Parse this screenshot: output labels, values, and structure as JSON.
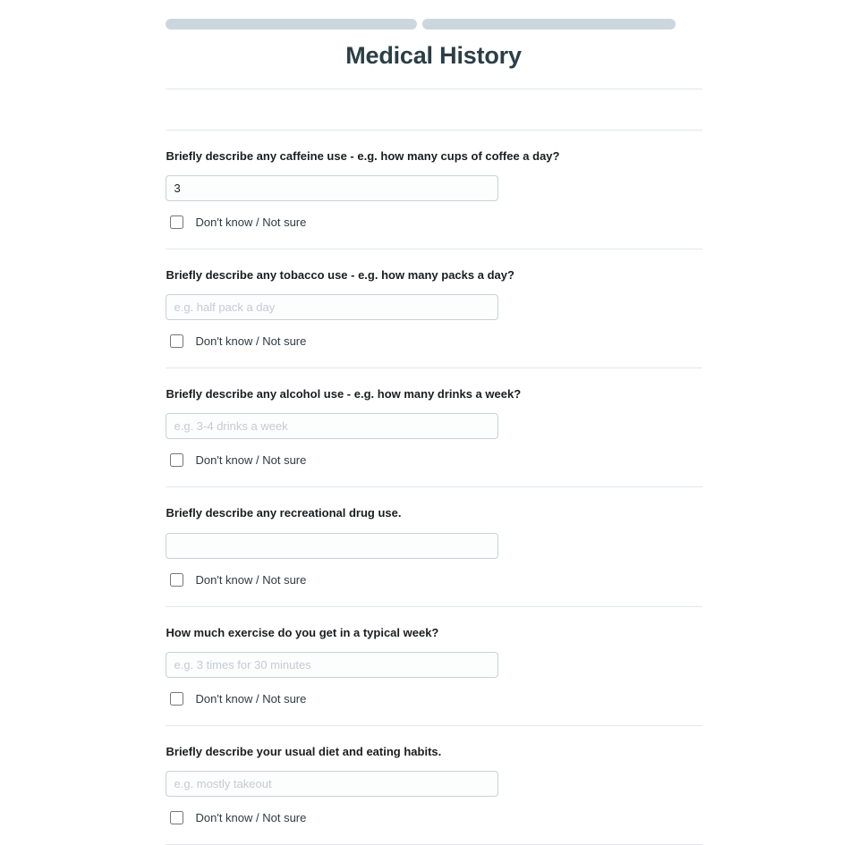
{
  "header": {
    "title": "Medical History",
    "progress": {
      "segments": [
        {
          "name": "segment-1",
          "color": "#ccd6dd",
          "filled": true
        },
        {
          "name": "segment-2",
          "color": "#ccd6dd",
          "filled": true
        }
      ]
    }
  },
  "checkbox_label": "Don't know / Not sure",
  "questions": [
    {
      "label": "Briefly describe any caffeine use - e.g. how many cups of coffee a day?",
      "value": "3",
      "placeholder": "",
      "dont_know_label": "Don't know / Not sure",
      "dont_know_checked": false
    },
    {
      "label": "Briefly describe any tobacco use - e.g. how many packs a day?",
      "value": "",
      "placeholder": "e.g. half pack a day",
      "dont_know_label": "Don't know / Not sure",
      "dont_know_checked": false
    },
    {
      "label": "Briefly describe any alcohol use - e.g. how many drinks a week?",
      "value": "",
      "placeholder": "e.g. 3-4 drinks a week",
      "dont_know_label": "Don't know / Not sure",
      "dont_know_checked": false
    },
    {
      "label": "Briefly describe any recreational drug use.",
      "value": "",
      "placeholder": "",
      "dont_know_label": "Don't know / Not sure",
      "dont_know_checked": false
    },
    {
      "label": "How much exercise do you get in a typical week?",
      "value": "",
      "placeholder": "e.g. 3 times for 30 minutes",
      "dont_know_label": "Don't know / Not sure",
      "dont_know_checked": false
    },
    {
      "label": "Briefly describe your usual diet and eating habits.",
      "value": "",
      "placeholder": "e.g. mostly takeout",
      "dont_know_label": "Don't know / Not sure",
      "dont_know_checked": false
    }
  ],
  "colors": {
    "progress_fill": "#ccd6dd",
    "title": "#2c3e46",
    "divider": "#e3e8ec",
    "input_border": "#c8d2d8",
    "placeholder": "#c3ccd3",
    "label": "#1b1d1f"
  }
}
